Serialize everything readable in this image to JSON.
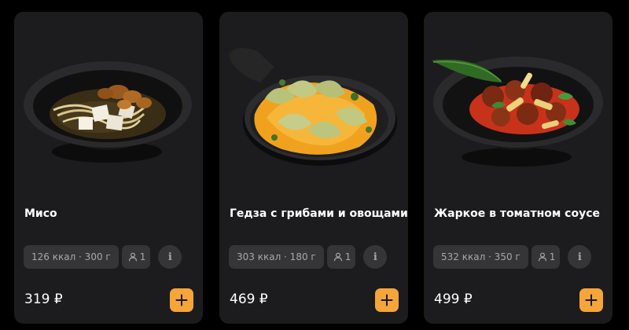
{
  "menu": {
    "items": [
      {
        "name": "Мисо",
        "kcal_weight": "126 ккал · 300 г",
        "portions": "1",
        "info_icon": "info-icon",
        "price": "319 ₽",
        "add_icon": "plus-icon"
      },
      {
        "name": "Гедза с грибами и овощами",
        "kcal_weight": "303 ккал · 180 г",
        "portions": "1",
        "info_icon": "info-icon",
        "price": "469 ₽",
        "add_icon": "plus-icon"
      },
      {
        "name": "Жаркое в томатном соусе",
        "kcal_weight": "532 ккал · 350 г",
        "portions": "1",
        "info_icon": "info-icon",
        "price": "499 ₽",
        "add_icon": "plus-icon"
      }
    ]
  },
  "colors": {
    "page_background": "#000000",
    "card_background": "#1c1c1e",
    "chip_background": "#353537",
    "chip_text": "#a7a7ab",
    "accent": "#f5a53a"
  }
}
